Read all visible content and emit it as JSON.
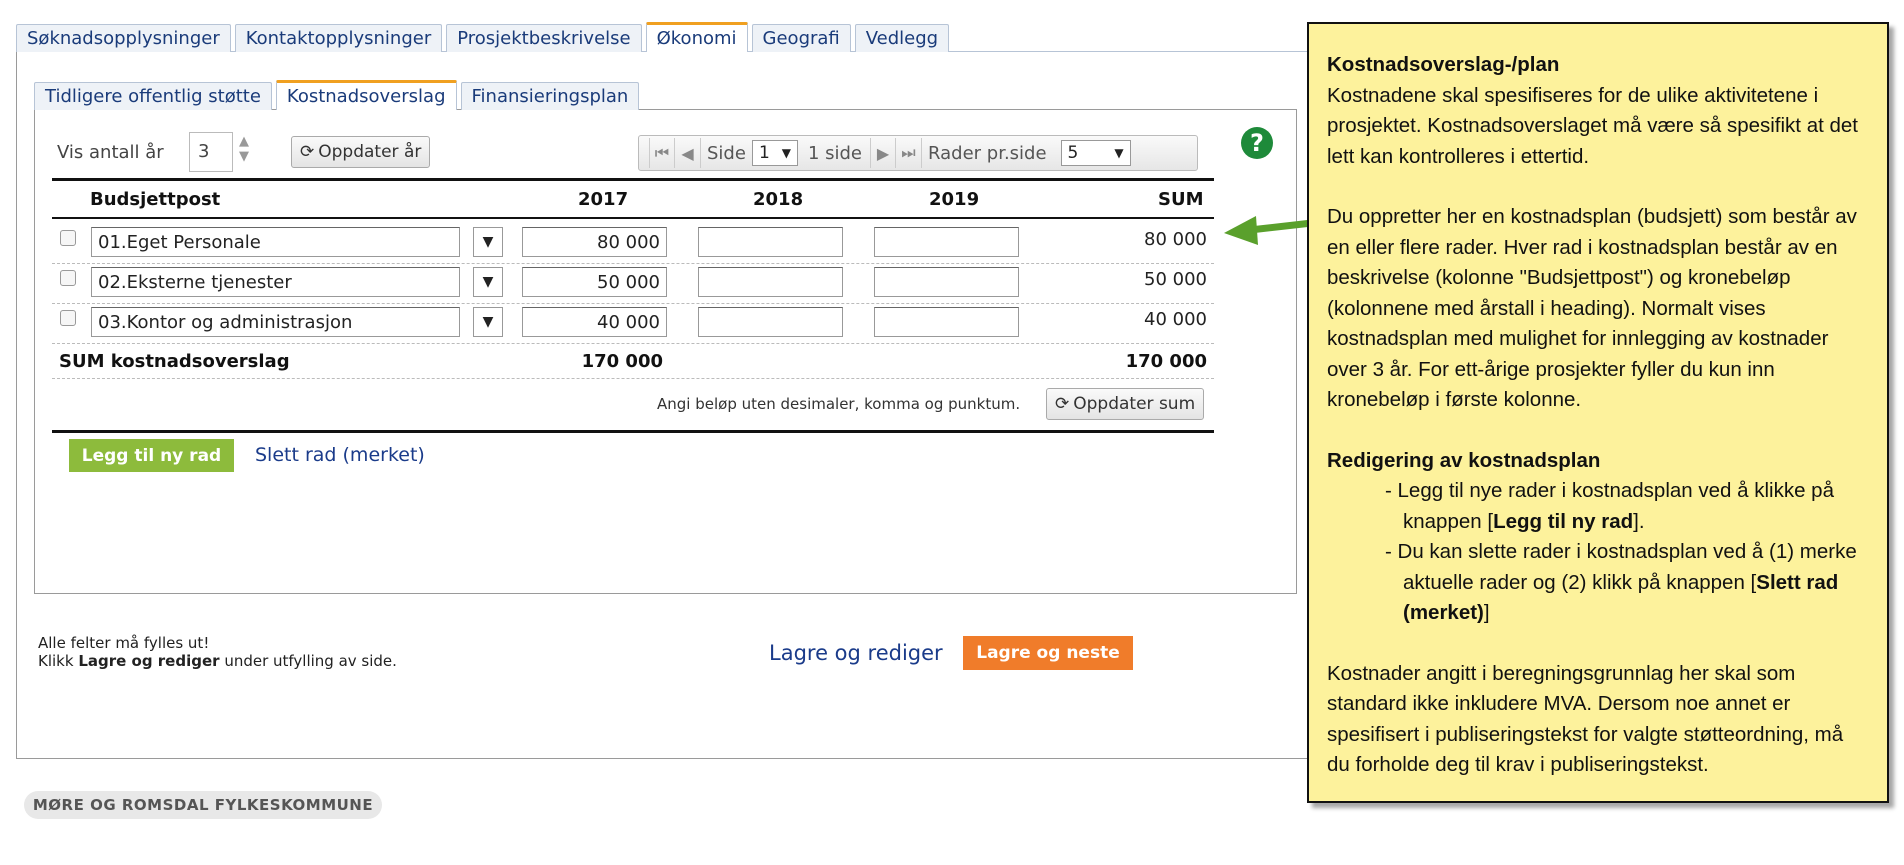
{
  "top_tabs": [
    "Søknadsopplysninger",
    "Kontaktopplysninger",
    "Prosjektbeskrivelse",
    "Økonomi",
    "Geografi",
    "Vedlegg"
  ],
  "sub_tabs": [
    "Tidligere offentlig støtte",
    "Kostnadsoverslag",
    "Finansieringsplan"
  ],
  "toolbar": {
    "vis_label": "Vis antall år",
    "vis_value": "3",
    "update_years": "Oppdater år",
    "page_label": "Side",
    "page_value": "1",
    "page_count": "1 side",
    "rows_label": "Rader pr.side",
    "rows_value": "5",
    "help": "?"
  },
  "table": {
    "headers": {
      "post": "Budsjettpost",
      "y1": "2017",
      "y2": "2018",
      "y3": "2019",
      "sum": "SUM"
    },
    "rows": [
      {
        "post": "01.Eget Personale",
        "y1": "80 000",
        "y2": "",
        "y3": "",
        "sum": "80 000"
      },
      {
        "post": "02.Eksterne tjenester",
        "y1": "50 000",
        "y2": "",
        "y3": "",
        "sum": "50 000"
      },
      {
        "post": "03.Kontor og administrasjon",
        "y1": "40 000",
        "y2": "",
        "y3": "",
        "sum": "40 000"
      }
    ],
    "total_label": "SUM kostnadsoverslag",
    "total_y1": "170 000",
    "total_sum": "170 000",
    "hint": "Angi beløp uten desimaler, komma og punktum.",
    "update_sum": "Oppdater sum"
  },
  "actions": {
    "add_row": "Legg til ny rad",
    "delete_row": "Slett rad (merket)"
  },
  "bottom": {
    "note1": "Alle felter må fylles ut!",
    "note2_pre": "Klikk ",
    "note2_bold": "Lagre og rediger",
    "note2_post": " under utfylling av side.",
    "save_edit": "Lagre og rediger",
    "save_next": "Lagre og neste"
  },
  "footer": "MØRE OG ROMSDAL FYLKESKOMMUNE",
  "note": {
    "h1": "Kostnadsoverslag-/plan",
    "p1": "Kostnadene skal spesifiseres for de ulike aktivitetene i prosjektet. Kostnadsoverslaget må være så spesifikt at det lett kan kontrolleres i ettertid.",
    "p2": "Du oppretter her en kostnadsplan (budsjett) som består av en eller flere rader. Hver rad i kostnadsplan består av en beskrivelse (kolonne \"Budsjettpost\") og kronebeløp (kolonnene med årstall i heading). Normalt vises kostnadsplan med mulighet for innlegging av kostnader over 3 år. For ett-årige prosjekter fyller du kun inn kronebeløp i første kolonne.",
    "h2": "Redigering av kostnadsplan",
    "li1_pre": "- Legg til nye rader i kostnadsplan ved å klikke på knappen [",
    "li1_bold": "Legg til ny rad",
    "li1_post": "].",
    "li2_pre": "- Du kan slette rader i kostnadsplan ved å (1) merke aktuelle rader og (2) klikk på knappen [",
    "li2_bold": "Slett rad (merket)",
    "li2_post": "]",
    "p3": "Kostnader angitt i beregningsgrunnlag her skal som standard ikke inkludere MVA. Dersom noe annet er spesifisert i publiseringstekst for valgte støtteordning, må du forholde deg til krav i publiseringstekst."
  },
  "colors": {
    "accent_green": "#8dbb3c",
    "accent_orange": "#f07c2a",
    "note_bg": "#fdf29c",
    "arrow": "#5aa02c"
  }
}
